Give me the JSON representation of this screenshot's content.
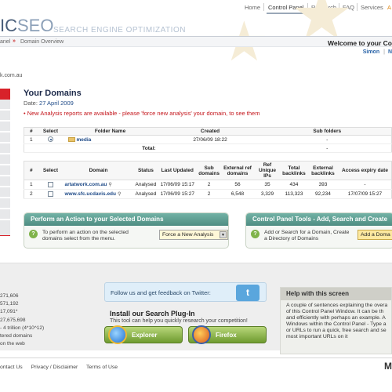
{
  "nav": {
    "items": [
      "Home",
      "Control Panel",
      "Research",
      "FAQ",
      "Services",
      "A"
    ]
  },
  "logo": {
    "text_dark": "IC",
    "text_light": "SEO",
    "tagline": "SEARCH ENGINE OPTIMIZATION"
  },
  "breadcrumb": {
    "item1": "anel",
    "item2": "Domain Overview"
  },
  "welcome": {
    "text": "Welcome to your Co",
    "user": "Simon",
    "sep": "|",
    "link": "N"
  },
  "site_url": "k.com.au",
  "main": {
    "title": "Your Domains",
    "date_label": "Date:",
    "date_value": "27 April 2009",
    "notice": "• New Analysis reports are available - please 'force new analysis' your domain, to see them"
  },
  "folder_table": {
    "headers": [
      "#",
      "Select",
      "Folder Name",
      "Created",
      "Sub folders"
    ],
    "row": {
      "num": "1",
      "name": "media",
      "created": "27/06/09 18:22",
      "sub": "-"
    },
    "total_label": "Total:",
    "total_value": "-"
  },
  "domain_table": {
    "headers": [
      "#",
      "Select",
      "Domain",
      "Status",
      "Last Updated",
      "Sub domains",
      "External ref domains",
      "Ref Unique IPs",
      "Total backlinks",
      "External backlinks",
      "Access expiry date"
    ],
    "rows": [
      {
        "num": "1",
        "domain": "artatwork.com.au",
        "status": "Analysed",
        "updated": "17/06/09 15:17",
        "sub": "2",
        "ext_ref": "56",
        "ips": "35",
        "total": "434",
        "ext_back": "393",
        "expiry": "-"
      },
      {
        "num": "2",
        "domain": "www.sfc.ucdavis.edu",
        "status": "Analysed",
        "updated": "17/06/09 15:27",
        "sub": "2",
        "ext_ref": "6,548",
        "ips": "3,329",
        "total": "113,323",
        "ext_back": "92,234",
        "expiry": "17/07/09 15:27"
      }
    ]
  },
  "panel_action": {
    "title": "Perform an Action to your Selected Domains",
    "text1": "To perform an action on the selected",
    "text2": "domains select from the menu.",
    "select_value": "Force a New Analysis",
    "go": "GO"
  },
  "panel_tools": {
    "title": "Control Panel Tools - Add, Search and Create",
    "text1": "Add or Search for a Domain, Create",
    "text2": "a Directory of Domains",
    "button": "Add a Doma"
  },
  "stats": [
    "271,606",
    "571,192",
    "17,091*",
    "27,675,698",
    "- 4 trillion (4*10^12)",
    "tered domains",
    "on the web"
  ],
  "twitter": {
    "text": "Follow us and get feedback on Twitter:",
    "icon": "t"
  },
  "plugin": {
    "title": "Install our Search Plug-In",
    "subtitle": "This tool can help you quickly research your competition!",
    "explorer": "Explorer",
    "firefox": "Firefox"
  },
  "help": {
    "title": "Help with this screen",
    "lines": [
      "A couple of sentences explaining the overa",
      "of this Control Panel Window. It can be th",
      "and efficiently with perhaps an example. A",
      "Windows within the Control Panel - Type a",
      "or URLs to run a quick, free search and se",
      "most important URLs on it"
    ]
  },
  "footer": {
    "links": [
      "ontact Us",
      "Privacy / Disclaimer",
      "Terms of Use"
    ],
    "logo": "M"
  },
  "colors": {
    "accent_red": "#d8222a",
    "link_blue": "#1f4b88",
    "panel_teal": "#5d9f93",
    "go_green": "#78ae38"
  }
}
